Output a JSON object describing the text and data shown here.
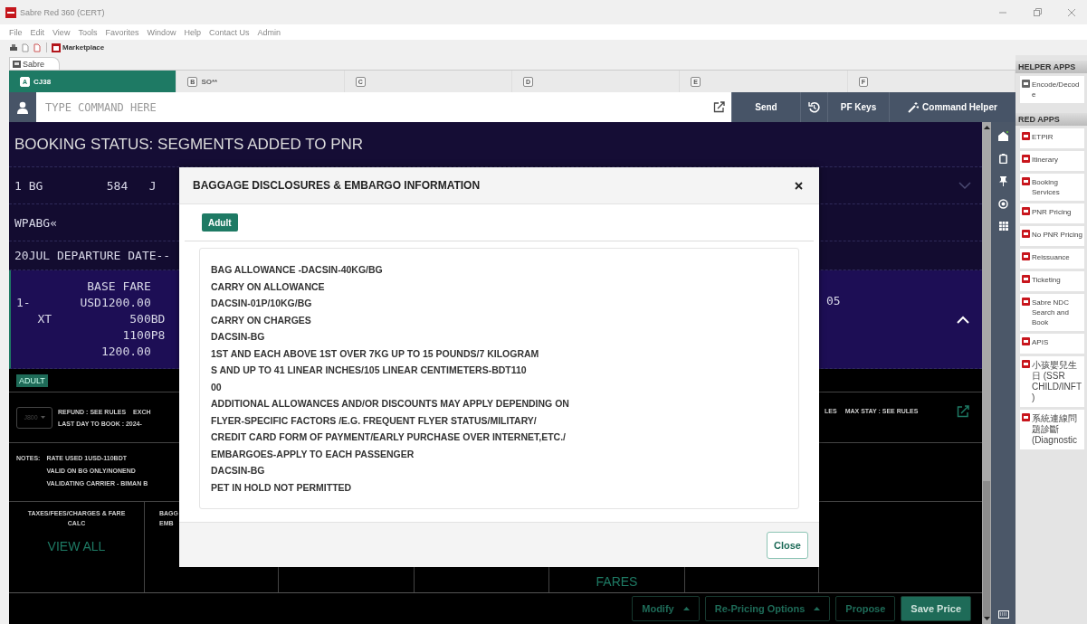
{
  "window": {
    "title": "Sabre Red 360 (CERT)"
  },
  "menu": [
    "File",
    "Edit",
    "View",
    "Tools",
    "Favorites",
    "Window",
    "Help",
    "Contact Us",
    "Admin"
  ],
  "toolbar": {
    "marketplace": "Marketplace"
  },
  "workspace_tab": {
    "label": "Sabre",
    "selected": true
  },
  "session_tabs": [
    {
      "letter": "A",
      "label": "CJ38",
      "selected": true
    },
    {
      "letter": "B",
      "label": "SO**",
      "selected": false
    },
    {
      "letter": "C",
      "selected": false
    },
    {
      "letter": "D",
      "selected": false
    },
    {
      "letter": "E",
      "selected": false
    },
    {
      "letter": "F",
      "selected": false
    }
  ],
  "command": {
    "placeholder": "TYPE COMMAND HERE",
    "send": "Send",
    "pf_keys": "PF Keys",
    "command_helper": "Command Helper"
  },
  "response": {
    "heading": "BOOKING STATUS: SEGMENTS ADDED TO PNR",
    "rows": [
      {
        "kind": "segment",
        "text": "1 BG         584   J",
        "expanded": false
      },
      {
        "kind": "line",
        "text": "WPABG«"
      },
      {
        "kind": "short",
        "text": "20JUL DEPARTURE DATE--"
      },
      {
        "kind": "fare",
        "lines": [
          "          BASE FARE",
          "1-       USD1200.00",
          "   XT           500BD",
          "               1100P8",
          "            1200.00"
        ],
        "right_text": "05",
        "expanded": true
      }
    ]
  },
  "passenger": {
    "label": "ADULT"
  },
  "fare_rules": {
    "fare_basis": "J800",
    "line_1": [
      "REFUND : SEE RULES",
      "EXCH"
    ],
    "line_2": "LAST DAY TO BOOK : 2024-",
    "right": [
      "LES",
      "MAX STAY : SEE RULES"
    ]
  },
  "notes": {
    "label": "NOTES:",
    "lines": [
      "RATE USED 1USD-110BDT",
      "VALID ON BG ONLY/NONEND",
      "VALIDATING CARRIER - BIMAN B"
    ]
  },
  "summary": {
    "cells": [
      {
        "title_lines": [
          "TAXES/FEES/CHARGES & FARE",
          "CALC"
        ],
        "link": "VIEW ALL"
      },
      {
        "title_lines": [
          "BAGG",
          "EMB"
        ]
      }
    ],
    "fares_link": "FARES"
  },
  "actions": [
    {
      "kind": "menu",
      "label": "Modify"
    },
    {
      "kind": "menu",
      "label": "Re-Pricing Options"
    },
    {
      "kind": "plain",
      "label": "Propose"
    },
    {
      "kind": "primary",
      "label": "Save Price"
    }
  ],
  "dialog": {
    "title": "BAGGAGE DISCLOSURES & EMBARGO INFORMATION",
    "tabs": [
      {
        "label": "Adult",
        "selected": true
      }
    ],
    "lines": [
      "BAG ALLOWANCE -DACSIN-40KG/BG",
      "CARRY ON ALLOWANCE",
      "DACSIN-01P/10KG/BG",
      "CARRY ON CHARGES",
      "DACSIN-BG",
      "1ST AND EACH ABOVE 1ST OVER 7KG UP TO 15 POUNDS/7 KILOGRAM",
      "S AND UP TO 41 LINEAR INCHES/105 LINEAR CENTIMETERS-BDT110",
      "00",
      "ADDITIONAL ALLOWANCES AND/OR DISCOUNTS MAY APPLY DEPENDING ON",
      "FLYER-SPECIFIC FACTORS /E.G. FREQUENT FLYER STATUS/MILITARY/",
      "CREDIT CARD FORM OF PAYMENT/EARLY PURCHASE OVER INTERNET,ETC./",
      "EMBARGOES-APPLY TO EACH PASSENGER",
      "DACSIN-BG",
      "PET IN HOLD NOT PERMITTED"
    ],
    "close": "Close"
  },
  "helper_apps": {
    "heading": "HELPER APPS",
    "items": [
      "Encode/Decode"
    ]
  },
  "red_apps": {
    "heading": "RED APPS",
    "items": [
      "ETPIR",
      "Itinerary",
      "Booking Services",
      "PNR Pricing",
      "No PNR Pricing",
      "Reissuance",
      "Ticketing",
      "Sabre NDC Search and Book",
      "APIS",
      "小孩嬰兒生日 (SSR CHILD/INFT)",
      "系統連線問題診斷 (Diagnostic"
    ]
  }
}
